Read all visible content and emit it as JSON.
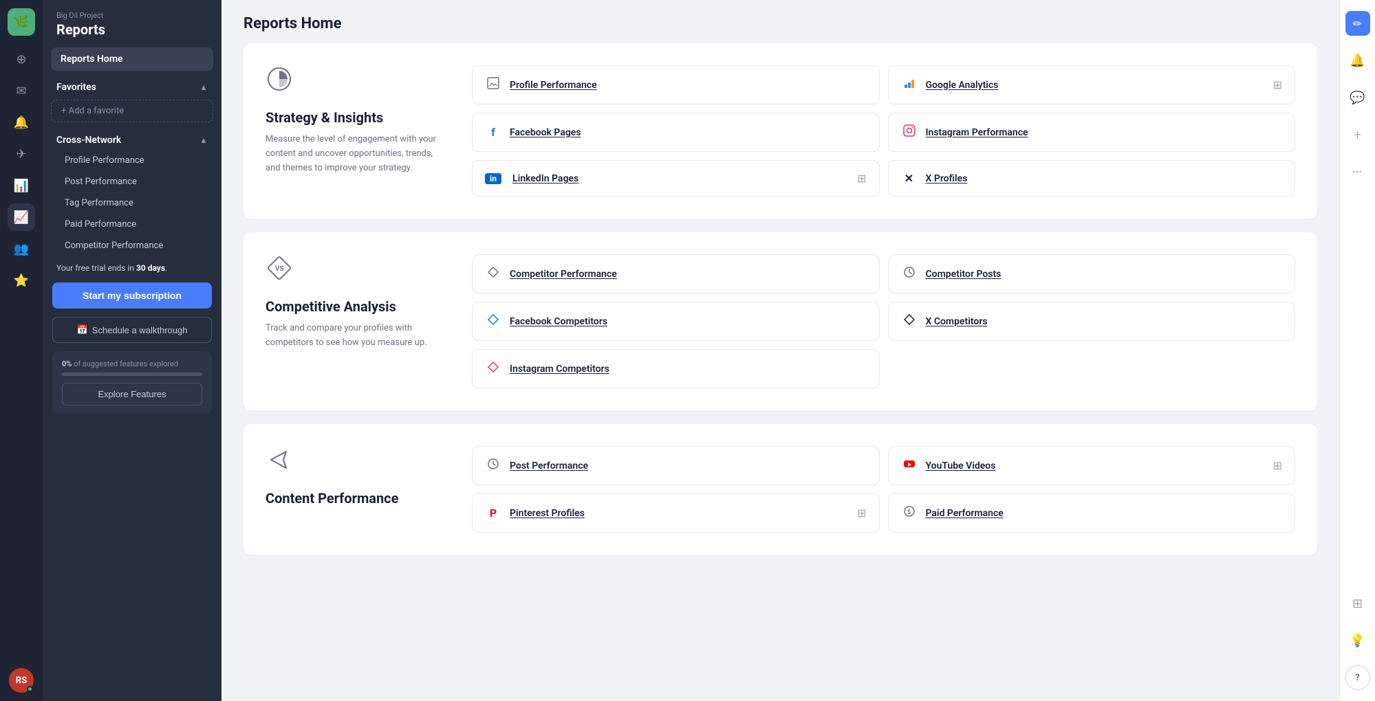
{
  "app": {
    "brand_icon": "🌿",
    "project_label": "Big Dil Project",
    "sidebar_title": "Reports",
    "reports_home_label": "Reports Home",
    "page_title": "Reports Home"
  },
  "sidebar": {
    "favorites": {
      "label": "Favorites",
      "add_label": "+ Add a favorite"
    },
    "cross_network": {
      "label": "Cross-Network",
      "items": [
        {
          "label": "Profile Performance"
        },
        {
          "label": "Post Performance"
        },
        {
          "label": "Tag Performance"
        },
        {
          "label": "Paid Performance"
        },
        {
          "label": "Competitor Performance"
        }
      ]
    },
    "trial": {
      "text_before": "Your free trial ends in ",
      "days": "30 days",
      "text_after": "."
    },
    "btn_subscription": "Start my subscription",
    "btn_walkthrough_icon": "📅",
    "btn_walkthrough": "Schedule a walkthrough",
    "progress": {
      "label_before": "0%",
      "label_after": " of suggested features explored",
      "pct": 0
    },
    "btn_explore": "Explore Features"
  },
  "sections": [
    {
      "id": "strategy",
      "icon": "📊",
      "title": "Strategy & Insights",
      "desc": "Measure the level of engagement with your content and uncover opportunities, trends, and themes to improve your strategy.",
      "reports": [
        {
          "id": "profile-performance",
          "icon": "📁",
          "icon_color": "#6b7280",
          "label": "Profile Performance",
          "action": null
        },
        {
          "id": "google-analytics",
          "icon": "📊",
          "icon_color": "#f59e0b",
          "label": "Google Analytics",
          "action": "+"
        },
        {
          "id": "facebook-pages",
          "icon": "f",
          "icon_color": "#1877f2",
          "label": "Facebook Pages",
          "action": null
        },
        {
          "id": "instagram-performance",
          "icon": "📷",
          "icon_color": "#e1306c",
          "label": "Instagram Performance",
          "action": null
        },
        {
          "id": "linkedin-pages",
          "icon": "in",
          "icon_color": "#0a66c2",
          "label": "LinkedIn Pages",
          "action": "+"
        },
        {
          "id": "x-profiles",
          "icon": "✕",
          "icon_color": "#1a2035",
          "label": "X Profiles",
          "action": null
        }
      ]
    },
    {
      "id": "competitive",
      "icon": "◇",
      "title": "Competitive Analysis",
      "desc": "Track and compare your profiles with competitors to see how you measure up.",
      "reports": [
        {
          "id": "competitor-performance",
          "icon": "◇",
          "icon_color": "#6b7280",
          "label": "Competitor Performance",
          "action": null
        },
        {
          "id": "competitor-posts",
          "icon": "⏱",
          "icon_color": "#6b7280",
          "label": "Competitor Posts",
          "action": null
        },
        {
          "id": "facebook-competitors",
          "icon": "◇",
          "icon_color": "#1877f2",
          "label": "Facebook Competitors",
          "action": null
        },
        {
          "id": "x-competitors",
          "icon": "◇",
          "icon_color": "#1a2035",
          "label": "X Competitors",
          "action": null
        },
        {
          "id": "instagram-competitors",
          "icon": "◇",
          "icon_color": "#e1306c",
          "label": "Instagram Competitors",
          "action": null,
          "span": true
        }
      ]
    },
    {
      "id": "content",
      "icon": "✈",
      "title": "Content Performance",
      "desc": "",
      "reports": [
        {
          "id": "post-performance",
          "icon": "⏱",
          "icon_color": "#6b7280",
          "label": "Post Performance",
          "action": null
        },
        {
          "id": "youtube-videos",
          "icon": "▶",
          "icon_color": "#ff0000",
          "label": "YouTube Videos",
          "action": "+"
        },
        {
          "id": "pinterest-profiles",
          "icon": "P",
          "icon_color": "#e60023",
          "label": "Pinterest Profiles",
          "action": "+"
        },
        {
          "id": "paid-performance",
          "icon": "$",
          "icon_color": "#6b7280",
          "label": "Paid Performance",
          "action": null
        }
      ]
    }
  ],
  "right_rail": {
    "edit_icon": "✏",
    "bell_icon": "🔔",
    "chat_icon": "💬",
    "add_icon": "+",
    "more_icon": "•••",
    "table_icon": "⊞",
    "bulb_icon": "💡",
    "help_icon": "?"
  }
}
